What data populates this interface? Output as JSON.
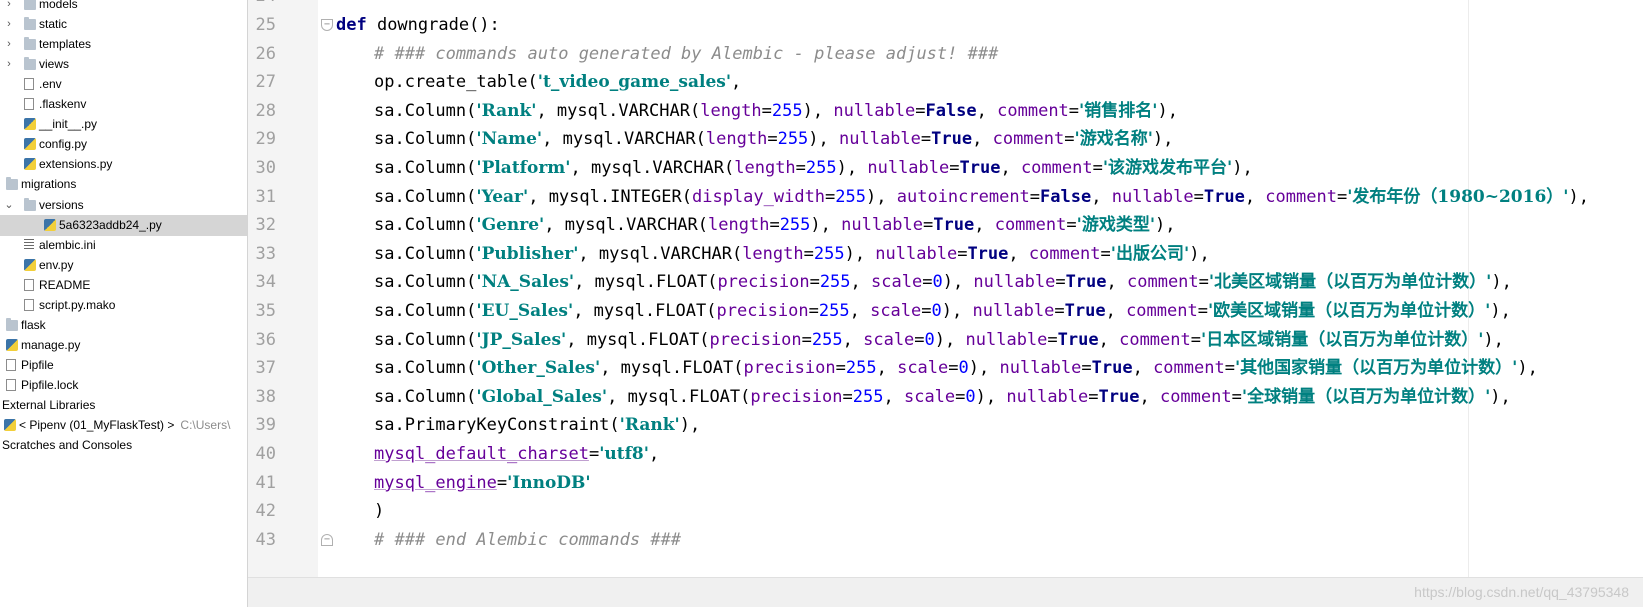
{
  "sidebar": {
    "items": [
      {
        "label": "models",
        "type": "folder",
        "depth": 1,
        "arrow": "›"
      },
      {
        "label": "static",
        "type": "folder",
        "depth": 1,
        "arrow": "›"
      },
      {
        "label": "templates",
        "type": "folder",
        "depth": 1,
        "arrow": "›"
      },
      {
        "label": "views",
        "type": "folder",
        "depth": 1,
        "arrow": "›"
      },
      {
        "label": ".env",
        "type": "file",
        "depth": 1
      },
      {
        "label": ".flaskenv",
        "type": "file",
        "depth": 1
      },
      {
        "label": "__init__.py",
        "type": "py",
        "depth": 1
      },
      {
        "label": "config.py",
        "type": "py",
        "depth": 1
      },
      {
        "label": "extensions.py",
        "type": "py",
        "depth": 1
      },
      {
        "label": "migrations",
        "type": "folder",
        "depth": 0
      },
      {
        "label": "versions",
        "type": "folder",
        "depth": 1,
        "arrow": "⌄"
      },
      {
        "label": "5a6323addb24_.py",
        "type": "py",
        "depth": 2,
        "selected": true
      },
      {
        "label": "alembic.ini",
        "type": "ini",
        "depth": 1
      },
      {
        "label": "env.py",
        "type": "py",
        "depth": 1
      },
      {
        "label": "README",
        "type": "file",
        "depth": 1
      },
      {
        "label": "script.py.mako",
        "type": "file",
        "depth": 1
      },
      {
        "label": "flask",
        "type": "folder",
        "depth": 0
      },
      {
        "label": "manage.py",
        "type": "py",
        "depth": 0
      },
      {
        "label": "Pipfile",
        "type": "file",
        "depth": 0
      },
      {
        "label": "Pipfile.lock",
        "type": "file",
        "depth": 0
      },
      {
        "label": "External Libraries",
        "type": "lib",
        "depth": -1
      },
      {
        "label": "< Pipenv (01_MyFlaskTest) >",
        "extra": "C:\\Users\\",
        "type": "py",
        "depth": -1
      },
      {
        "label": "Scratches and Consoles",
        "type": "cons",
        "depth": -1
      }
    ]
  },
  "editor": {
    "top_partial_line": "24",
    "lines": [
      {
        "n": "25",
        "indent": 0,
        "fold": "open",
        "tokens": [
          [
            "kw",
            "def"
          ],
          [
            "fn",
            " downgrade():"
          ]
        ]
      },
      {
        "n": "26",
        "indent": 1,
        "tokens": [
          [
            "cm",
            "# ### commands auto generated by Alembic - please adjust! ###"
          ]
        ]
      },
      {
        "n": "27",
        "indent": 1,
        "tokens": [
          [
            "id",
            "op.create_table("
          ],
          [
            "st",
            "'t_video_game_sales'"
          ],
          [
            "id",
            ","
          ]
        ]
      },
      {
        "n": "28",
        "indent": 1,
        "tokens": [
          [
            "id",
            "sa.Column("
          ],
          [
            "st",
            "'Rank'"
          ],
          [
            "id",
            ", mysql.VARCHAR("
          ],
          [
            "pm",
            "length"
          ],
          [
            "id",
            "="
          ],
          [
            "nm",
            "255"
          ],
          [
            "id",
            "), "
          ],
          [
            "pm",
            "nullable"
          ],
          [
            "id",
            "="
          ],
          [
            "kw",
            "False"
          ],
          [
            "id",
            ", "
          ],
          [
            "pm",
            "comment"
          ],
          [
            "id",
            "="
          ],
          [
            "st",
            "'销售排名'"
          ],
          [
            "id",
            "),"
          ]
        ]
      },
      {
        "n": "29",
        "indent": 1,
        "tokens": [
          [
            "id",
            "sa.Column("
          ],
          [
            "st",
            "'Name'"
          ],
          [
            "id",
            ", mysql.VARCHAR("
          ],
          [
            "pm",
            "length"
          ],
          [
            "id",
            "="
          ],
          [
            "nm",
            "255"
          ],
          [
            "id",
            "), "
          ],
          [
            "pm",
            "nullable"
          ],
          [
            "id",
            "="
          ],
          [
            "kw",
            "True"
          ],
          [
            "id",
            ", "
          ],
          [
            "pm",
            "comment"
          ],
          [
            "id",
            "="
          ],
          [
            "st",
            "'游戏名称'"
          ],
          [
            "id",
            "),"
          ]
        ]
      },
      {
        "n": "30",
        "indent": 1,
        "tokens": [
          [
            "id",
            "sa.Column("
          ],
          [
            "st",
            "'Platform'"
          ],
          [
            "id",
            ", mysql.VARCHAR("
          ],
          [
            "pm",
            "length"
          ],
          [
            "id",
            "="
          ],
          [
            "nm",
            "255"
          ],
          [
            "id",
            "), "
          ],
          [
            "pm",
            "nullable"
          ],
          [
            "id",
            "="
          ],
          [
            "kw",
            "True"
          ],
          [
            "id",
            ", "
          ],
          [
            "pm",
            "comment"
          ],
          [
            "id",
            "="
          ],
          [
            "st",
            "'该游戏发布平台'"
          ],
          [
            "id",
            "),"
          ]
        ]
      },
      {
        "n": "31",
        "indent": 1,
        "tokens": [
          [
            "id",
            "sa.Column("
          ],
          [
            "st",
            "'Year'"
          ],
          [
            "id",
            ", mysql.INTEGER("
          ],
          [
            "pm",
            "display_width"
          ],
          [
            "id",
            "="
          ],
          [
            "nm",
            "255"
          ],
          [
            "id",
            "), "
          ],
          [
            "pm",
            "autoincrement"
          ],
          [
            "id",
            "="
          ],
          [
            "kw",
            "False"
          ],
          [
            "id",
            ", "
          ],
          [
            "pm",
            "nullable"
          ],
          [
            "id",
            "="
          ],
          [
            "kw",
            "True"
          ],
          [
            "id",
            ", "
          ],
          [
            "pm",
            "comment"
          ],
          [
            "id",
            "="
          ],
          [
            "st",
            "'发布年份（1980~2016）'"
          ],
          [
            "id",
            "),"
          ]
        ]
      },
      {
        "n": "32",
        "indent": 1,
        "tokens": [
          [
            "id",
            "sa.Column("
          ],
          [
            "st",
            "'Genre'"
          ],
          [
            "id",
            ", mysql.VARCHAR("
          ],
          [
            "pm",
            "length"
          ],
          [
            "id",
            "="
          ],
          [
            "nm",
            "255"
          ],
          [
            "id",
            "), "
          ],
          [
            "pm",
            "nullable"
          ],
          [
            "id",
            "="
          ],
          [
            "kw",
            "True"
          ],
          [
            "id",
            ", "
          ],
          [
            "pm",
            "comment"
          ],
          [
            "id",
            "="
          ],
          [
            "st",
            "'游戏类型'"
          ],
          [
            "id",
            "),"
          ]
        ]
      },
      {
        "n": "33",
        "indent": 1,
        "tokens": [
          [
            "id",
            "sa.Column("
          ],
          [
            "st",
            "'Publisher'"
          ],
          [
            "id",
            ", mysql.VARCHAR("
          ],
          [
            "pm",
            "length"
          ],
          [
            "id",
            "="
          ],
          [
            "nm",
            "255"
          ],
          [
            "id",
            "), "
          ],
          [
            "pm",
            "nullable"
          ],
          [
            "id",
            "="
          ],
          [
            "kw",
            "True"
          ],
          [
            "id",
            ", "
          ],
          [
            "pm",
            "comment"
          ],
          [
            "id",
            "="
          ],
          [
            "st",
            "'出版公司'"
          ],
          [
            "id",
            "),"
          ]
        ]
      },
      {
        "n": "34",
        "indent": 1,
        "tokens": [
          [
            "id",
            "sa.Column("
          ],
          [
            "st",
            "'NA_Sales'"
          ],
          [
            "id",
            ", mysql.FLOAT("
          ],
          [
            "pm",
            "precision"
          ],
          [
            "id",
            "="
          ],
          [
            "nm",
            "255"
          ],
          [
            "id",
            ", "
          ],
          [
            "pm",
            "scale"
          ],
          [
            "id",
            "="
          ],
          [
            "nm",
            "0"
          ],
          [
            "id",
            "), "
          ],
          [
            "pm",
            "nullable"
          ],
          [
            "id",
            "="
          ],
          [
            "kw",
            "True"
          ],
          [
            "id",
            ", "
          ],
          [
            "pm",
            "comment"
          ],
          [
            "id",
            "="
          ],
          [
            "st",
            "'北美区域销量（以百万为单位计数）'"
          ],
          [
            "id",
            "),"
          ]
        ]
      },
      {
        "n": "35",
        "indent": 1,
        "tokens": [
          [
            "id",
            "sa.Column("
          ],
          [
            "st",
            "'EU_Sales'"
          ],
          [
            "id",
            ", mysql.FLOAT("
          ],
          [
            "pm",
            "precision"
          ],
          [
            "id",
            "="
          ],
          [
            "nm",
            "255"
          ],
          [
            "id",
            ", "
          ],
          [
            "pm",
            "scale"
          ],
          [
            "id",
            "="
          ],
          [
            "nm",
            "0"
          ],
          [
            "id",
            "), "
          ],
          [
            "pm",
            "nullable"
          ],
          [
            "id",
            "="
          ],
          [
            "kw",
            "True"
          ],
          [
            "id",
            ", "
          ],
          [
            "pm",
            "comment"
          ],
          [
            "id",
            "="
          ],
          [
            "st",
            "'欧美区域销量（以百万为单位计数）'"
          ],
          [
            "id",
            "),"
          ]
        ]
      },
      {
        "n": "36",
        "indent": 1,
        "tokens": [
          [
            "id",
            "sa.Column("
          ],
          [
            "st",
            "'JP_Sales'"
          ],
          [
            "id",
            ", mysql.FLOAT("
          ],
          [
            "pm",
            "precision"
          ],
          [
            "id",
            "="
          ],
          [
            "nm",
            "255"
          ],
          [
            "id",
            ", "
          ],
          [
            "pm",
            "scale"
          ],
          [
            "id",
            "="
          ],
          [
            "nm",
            "0"
          ],
          [
            "id",
            "), "
          ],
          [
            "pm",
            "nullable"
          ],
          [
            "id",
            "="
          ],
          [
            "kw",
            "True"
          ],
          [
            "id",
            ", "
          ],
          [
            "pm",
            "comment"
          ],
          [
            "id",
            "="
          ],
          [
            "st",
            "'日本区域销量（以百万为单位计数）'"
          ],
          [
            "id",
            "),"
          ]
        ]
      },
      {
        "n": "37",
        "indent": 1,
        "tokens": [
          [
            "id",
            "sa.Column("
          ],
          [
            "st",
            "'Other_Sales'"
          ],
          [
            "id",
            ", mysql.FLOAT("
          ],
          [
            "pm",
            "precision"
          ],
          [
            "id",
            "="
          ],
          [
            "nm",
            "255"
          ],
          [
            "id",
            ", "
          ],
          [
            "pm",
            "scale"
          ],
          [
            "id",
            "="
          ],
          [
            "nm",
            "0"
          ],
          [
            "id",
            "), "
          ],
          [
            "pm",
            "nullable"
          ],
          [
            "id",
            "="
          ],
          [
            "kw",
            "True"
          ],
          [
            "id",
            ", "
          ],
          [
            "pm",
            "comment"
          ],
          [
            "id",
            "="
          ],
          [
            "st",
            "'其他国家销量（以百万为单位计数）'"
          ],
          [
            "id",
            "),"
          ]
        ]
      },
      {
        "n": "38",
        "indent": 1,
        "tokens": [
          [
            "id",
            "sa.Column("
          ],
          [
            "st",
            "'Global_Sales'"
          ],
          [
            "id",
            ", mysql.FLOAT("
          ],
          [
            "pm",
            "precision"
          ],
          [
            "id",
            "="
          ],
          [
            "nm",
            "255"
          ],
          [
            "id",
            ", "
          ],
          [
            "pm",
            "scale"
          ],
          [
            "id",
            "="
          ],
          [
            "nm",
            "0"
          ],
          [
            "id",
            "), "
          ],
          [
            "pm",
            "nullable"
          ],
          [
            "id",
            "="
          ],
          [
            "kw",
            "True"
          ],
          [
            "id",
            ", "
          ],
          [
            "pm",
            "comment"
          ],
          [
            "id",
            "="
          ],
          [
            "st",
            "'全球销量（以百万为单位计数）'"
          ],
          [
            "id",
            "),"
          ]
        ]
      },
      {
        "n": "39",
        "indent": 1,
        "tokens": [
          [
            "id",
            "sa.PrimaryKeyConstraint("
          ],
          [
            "st",
            "'Rank'"
          ],
          [
            "id",
            "),"
          ]
        ]
      },
      {
        "n": "40",
        "indent": 1,
        "tokens": [
          [
            "var",
            "mysql_default_charset"
          ],
          [
            "id",
            "="
          ],
          [
            "st",
            "'utf8'"
          ],
          [
            "id",
            ","
          ]
        ]
      },
      {
        "n": "41",
        "indent": 1,
        "tokens": [
          [
            "var",
            "mysql_engine"
          ],
          [
            "id",
            "="
          ],
          [
            "st",
            "'InnoDB'"
          ]
        ]
      },
      {
        "n": "42",
        "indent": 1,
        "tokens": [
          [
            "id",
            ")"
          ]
        ]
      },
      {
        "n": "43",
        "indent": 1,
        "fold": "close",
        "tokens": [
          [
            "cm",
            "# ### end Alembic commands ###"
          ]
        ]
      }
    ]
  },
  "watermark": "https://blog.csdn.net/qq_43795348"
}
